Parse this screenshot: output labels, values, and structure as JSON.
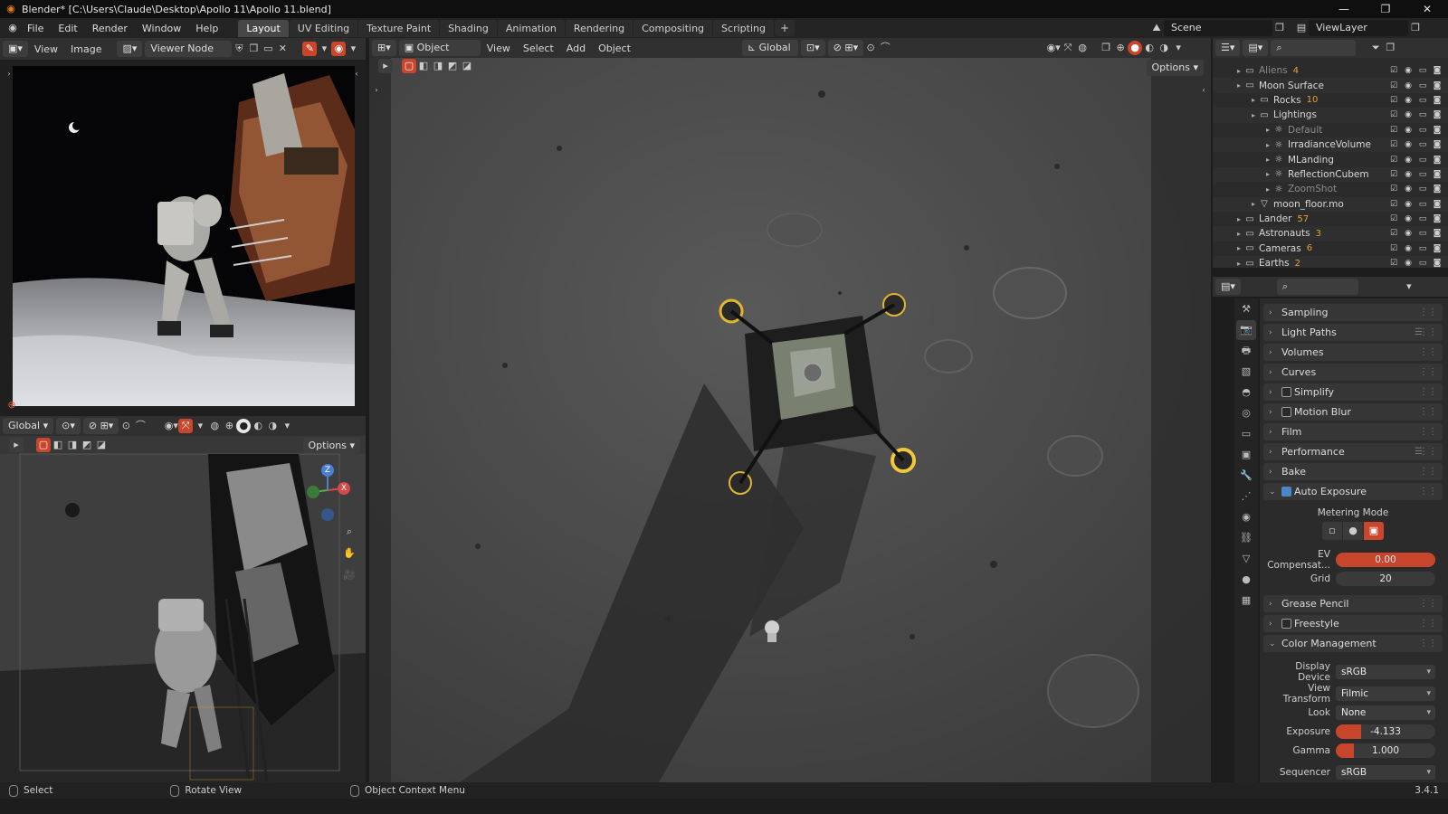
{
  "window": {
    "title": "Blender* [C:\\Users\\Claude\\Desktop\\Apollo 11\\Apollo 11.blend]",
    "controls": [
      "—",
      "❐",
      "✕"
    ]
  },
  "menu": [
    "File",
    "Edit",
    "Render",
    "Window",
    "Help"
  ],
  "workspaces": [
    "Layout",
    "UV Editing",
    "Texture Paint",
    "Shading",
    "Animation",
    "Rendering",
    "Compositing",
    "Scripting"
  ],
  "workspace_add": "+",
  "scene": "Scene",
  "view_layer": "ViewLayer",
  "image_editor": {
    "menus": [
      "View",
      "Image"
    ],
    "image_name": "Viewer Node"
  },
  "viewport_main": {
    "mode": "Object Mode",
    "menus": [
      "View",
      "Select",
      "Add",
      "Object"
    ],
    "transform": "Global",
    "options": "Options"
  },
  "viewport_left": {
    "transform": "Global",
    "options": "Options",
    "gizmo": {
      "z": "Z",
      "x": "X"
    }
  },
  "outliner": {
    "rows": [
      {
        "label": "Aliens",
        "badge": "4",
        "indent": 1,
        "dim": true
      },
      {
        "label": "Moon Surface",
        "badge": "",
        "indent": 1,
        "dim": false
      },
      {
        "label": "Rocks",
        "badge": "10",
        "indent": 2,
        "dim": false
      },
      {
        "label": "Lightings",
        "badge": "",
        "indent": 2,
        "dim": false
      },
      {
        "label": "Default",
        "badge": "",
        "indent": 3,
        "dim": true
      },
      {
        "label": "IrradianceVolume",
        "badge": "",
        "indent": 3,
        "dim": false
      },
      {
        "label": "MLanding",
        "badge": "",
        "indent": 3,
        "dim": false
      },
      {
        "label": "ReflectionCubem",
        "badge": "",
        "indent": 3,
        "dim": false
      },
      {
        "label": "ZoomShot",
        "badge": "",
        "indent": 3,
        "dim": true
      },
      {
        "label": "moon_floor.mo",
        "badge": "",
        "indent": 2,
        "dim": false
      },
      {
        "label": "Lander",
        "badge": "57",
        "indent": 1,
        "dim": false
      },
      {
        "label": "Astronauts",
        "badge": "3",
        "indent": 1,
        "dim": false
      },
      {
        "label": "Cameras",
        "badge": "6",
        "indent": 1,
        "dim": false
      },
      {
        "label": "Earths",
        "badge": "2",
        "indent": 1,
        "dim": false
      }
    ]
  },
  "properties": {
    "panels_top": [
      "Sampling",
      "Light Paths",
      "Volumes",
      "Curves",
      "Simplify",
      "Motion Blur",
      "Film",
      "Performance",
      "Bake",
      "Auto Exposure"
    ],
    "metering_mode_label": "Metering Mode",
    "ev_compensation": {
      "label": "EV Compensat...",
      "value": "0.00"
    },
    "grid": {
      "label": "Grid",
      "value": "20"
    },
    "panels_mid": [
      "Grease Pencil",
      "Freestyle",
      "Color Management"
    ],
    "color_management": {
      "display_device": {
        "label": "Display Device",
        "value": "sRGB"
      },
      "view_transform": {
        "label": "View Transform",
        "value": "Filmic"
      },
      "look": {
        "label": "Look",
        "value": "None"
      },
      "exposure": {
        "label": "Exposure",
        "value": "-4.133"
      },
      "gamma": {
        "label": "Gamma",
        "value": "1.000"
      },
      "sequencer": {
        "label": "Sequencer",
        "value": "sRGB"
      }
    }
  },
  "statusbar": {
    "select": "Select",
    "rotate": "Rotate View",
    "context": "Object Context Menu",
    "version": "3.4.1"
  },
  "accent": "#c7452a"
}
